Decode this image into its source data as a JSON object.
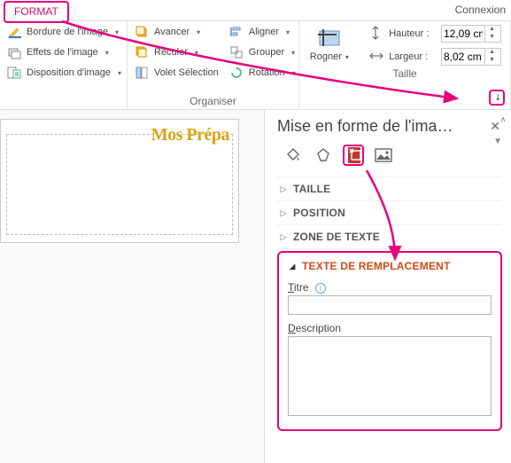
{
  "tab": {
    "format": "FORMAT",
    "connexion": "Connexion"
  },
  "ribbon": {
    "style": {
      "bordure": "Bordure de l'image",
      "effets": "Effets de l'image",
      "disposition": "Disposition d'image"
    },
    "organiser": {
      "avancer": "Avancer",
      "reculer": "Reculer",
      "volet": "Volet Sélection",
      "aligner": "Aligner",
      "grouper": "Grouper",
      "rotation": "Rotation",
      "label": "Organiser"
    },
    "taille": {
      "rogner": "Rogner",
      "hauteur": "Hauteur :",
      "hauteur_val": "12,09 cm",
      "largeur": "Largeur :",
      "largeur_val": "8,02 cm",
      "label": "Taille"
    }
  },
  "brand": "Mos Prépa",
  "pane": {
    "title": "Mise en forme de l'ima…",
    "sections": {
      "taille": "TAILLE",
      "position": "POSITION",
      "zone": "ZONE DE TEXTE",
      "alt": "TEXTE DE REMPLACEMENT"
    },
    "alt": {
      "titre_label": "Titre",
      "desc_label": "Description",
      "titre_val": "",
      "desc_val": ""
    }
  }
}
